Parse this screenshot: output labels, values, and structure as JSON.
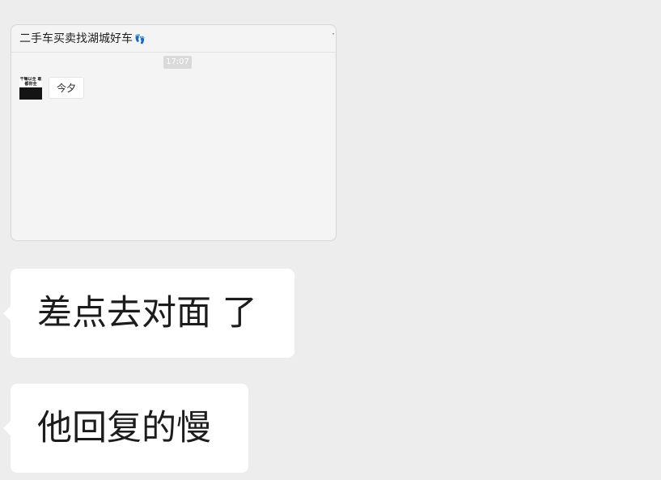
{
  "forwarded_card": {
    "title": "二手车买卖找湖城好车",
    "title_emoji": "👣",
    "corner_mark": "·",
    "timestamp": "17:07",
    "avatar_text": "干嘛以全 敢都你全",
    "message": "今夕"
  },
  "messages": [
    {
      "text": "差点去对面 了"
    },
    {
      "text": "他回复的慢"
    }
  ]
}
